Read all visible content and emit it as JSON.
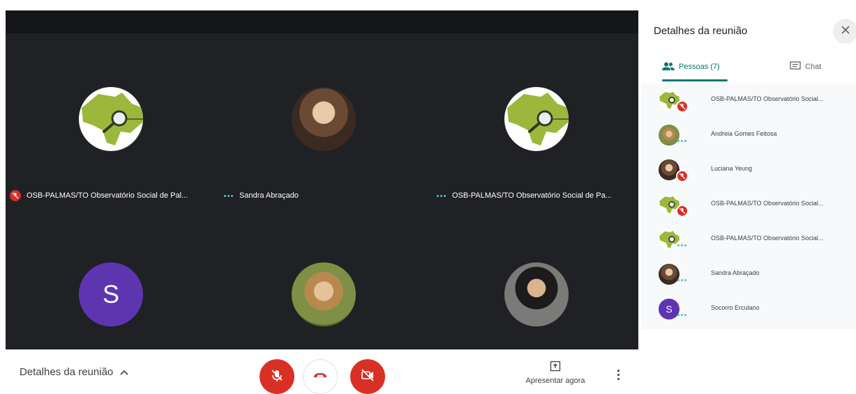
{
  "tiles": [
    {
      "name": "OSB-PALMAS/TO Observatório Social de Pal...",
      "status": "muted",
      "avatar": "map-logo"
    },
    {
      "name": "Sandra Abraçado",
      "status": "dots",
      "avatar": "photo"
    },
    {
      "name": "OSB-PALMAS/TO Observatório Social de Pa...",
      "status": "dots",
      "avatar": "map-logo"
    },
    {
      "letter": "S",
      "avatar": "letter"
    },
    {
      "avatar": "photo"
    },
    {
      "avatar": "photo"
    }
  ],
  "bottombar": {
    "details_label": "Detalhes da reunião",
    "present_label": "Apresentar agora"
  },
  "panel": {
    "title": "Detalhes da reunião",
    "tabs": {
      "people": "Pessoas (7)",
      "chat": "Chat"
    },
    "people": [
      {
        "name": "OSB-PALMAS/TO Observatório Social...",
        "status": "muted"
      },
      {
        "name": "Andreia Gomes Feitosa",
        "status": "dots"
      },
      {
        "name": "Luciana Yeung",
        "status": "muted"
      },
      {
        "name": "OSB-PALMAS/TO Observatório Social...",
        "status": "muted"
      },
      {
        "name": "OSB-PALMAS/TO Observatório Social...",
        "status": "dots"
      },
      {
        "name": "Sandra Abraçado",
        "status": "dots"
      },
      {
        "name": "Socorro Erculano",
        "status": "dots",
        "letter": "S"
      }
    ]
  },
  "colors": {
    "accent": "#00796b",
    "danger": "#d93025",
    "stage": "#202124",
    "letter_avatar": "#5e35b1"
  }
}
